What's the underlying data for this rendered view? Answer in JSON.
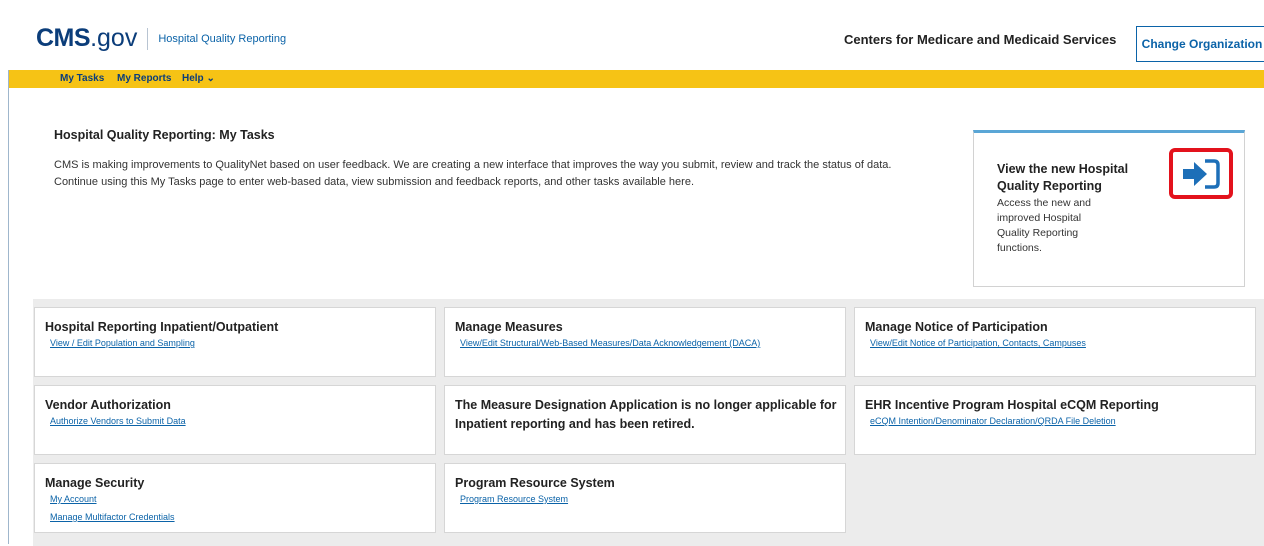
{
  "header": {
    "logo_cms": "CMS",
    "logo_gov": ".gov",
    "logo_sub": "Hospital Quality Reporting",
    "org_name": "Centers for Medicare and Medicaid Services",
    "change_org_label": "Change Organization"
  },
  "nav": {
    "items": [
      "My Tasks",
      "My Reports",
      "Help"
    ],
    "help_caret": "⌄"
  },
  "main": {
    "title": "Hospital Quality Reporting: My Tasks",
    "intro_line1": "CMS is making improvements to QualityNet based on user feedback. We are creating a new interface that improves the way you submit, review and track the status of data.",
    "intro_line2": "Continue using this My Tasks page to enter web-based data, view submission and feedback reports, and other tasks available here."
  },
  "promo": {
    "title": "View the new Hospital Quality Reporting",
    "desc": "Access the new and improved Hospital Quality Reporting functions.",
    "icon": "sign-in-arrow-icon",
    "icon_color": "#1d6fb8",
    "highlight_color": "#e3121c"
  },
  "cards": [
    {
      "title": "Hospital Reporting Inpatient/Outpatient",
      "links": [
        "View / Edit Population and Sampling"
      ]
    },
    {
      "title": "Manage Measures",
      "links": [
        "View/Edit Structural/Web-Based Measures/Data Acknowledgement (DACA)"
      ]
    },
    {
      "title": "Manage Notice of Participation",
      "links": [
        "View/Edit Notice of Participation, Contacts, Campuses"
      ]
    },
    {
      "title": "Vendor Authorization",
      "links": [
        "Authorize Vendors to Submit Data"
      ]
    },
    {
      "title": "The Measure Designation Application is no longer applicable for Inpatient reporting and has been retired.",
      "links": []
    },
    {
      "title": "EHR Incentive Program Hospital eCQM Reporting",
      "links": [
        "eCQM Intention/Denominator Declaration/QRDA File Deletion"
      ]
    },
    {
      "title": "Manage Security",
      "links": [
        "My Account",
        "Manage Multifactor Credentials"
      ]
    },
    {
      "title": "Program Resource System",
      "links": [
        "Program Resource System"
      ]
    }
  ],
  "colors": {
    "brand_blue": "#0b3d7a",
    "link_blue": "#0b63a8",
    "nav_yellow": "#f6c315"
  }
}
